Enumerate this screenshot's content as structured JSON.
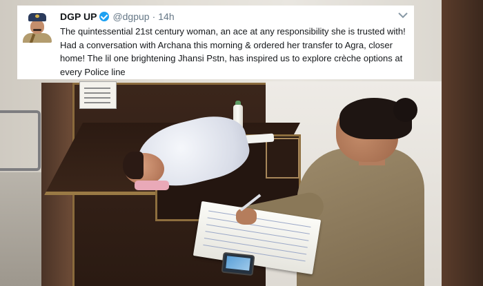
{
  "tweet": {
    "display_name": "DGP UP",
    "handle": "@dgpup",
    "separator": "·",
    "time": "14h",
    "text": "The quintessential 21st century woman, an ace at any responsibility she is trusted with! Had a conversation with Archana this morning & ordered her transfer to Agra, closer home! The lil one brightening Jhansi Pstn, has  inspired us to explore crèche options at every Police line",
    "menu_icon": "chevron-down-icon",
    "verified_icon": "verified-badge-icon"
  },
  "colors": {
    "verified": "#1da1f2",
    "name": "#14171a",
    "meta": "#657786"
  }
}
